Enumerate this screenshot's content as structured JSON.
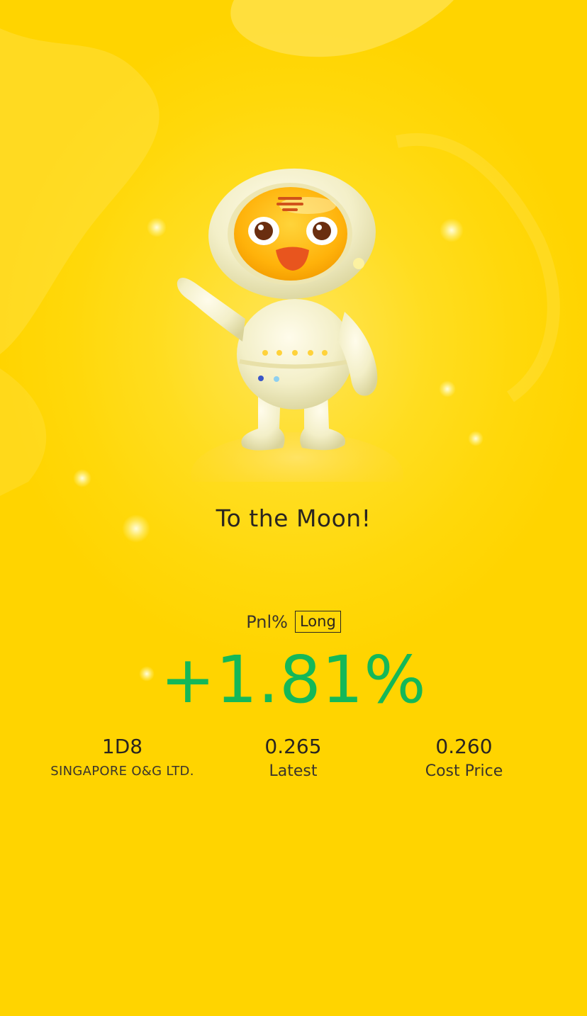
{
  "headline": "To the Moon!",
  "pnl": {
    "label": "Pnl%",
    "position_tag": "Long",
    "value": "+1.81%"
  },
  "stats": [
    {
      "value": "1D8",
      "label": "SINGAPORE O&G LTD."
    },
    {
      "value": "0.265",
      "label": "Latest"
    },
    {
      "value": "0.260",
      "label": "Cost Price"
    }
  ],
  "colors": {
    "background": "#FFD80A",
    "gain": "#14B858",
    "text": "#2A2520"
  },
  "illustration": "tiger-astronaut-mascot"
}
